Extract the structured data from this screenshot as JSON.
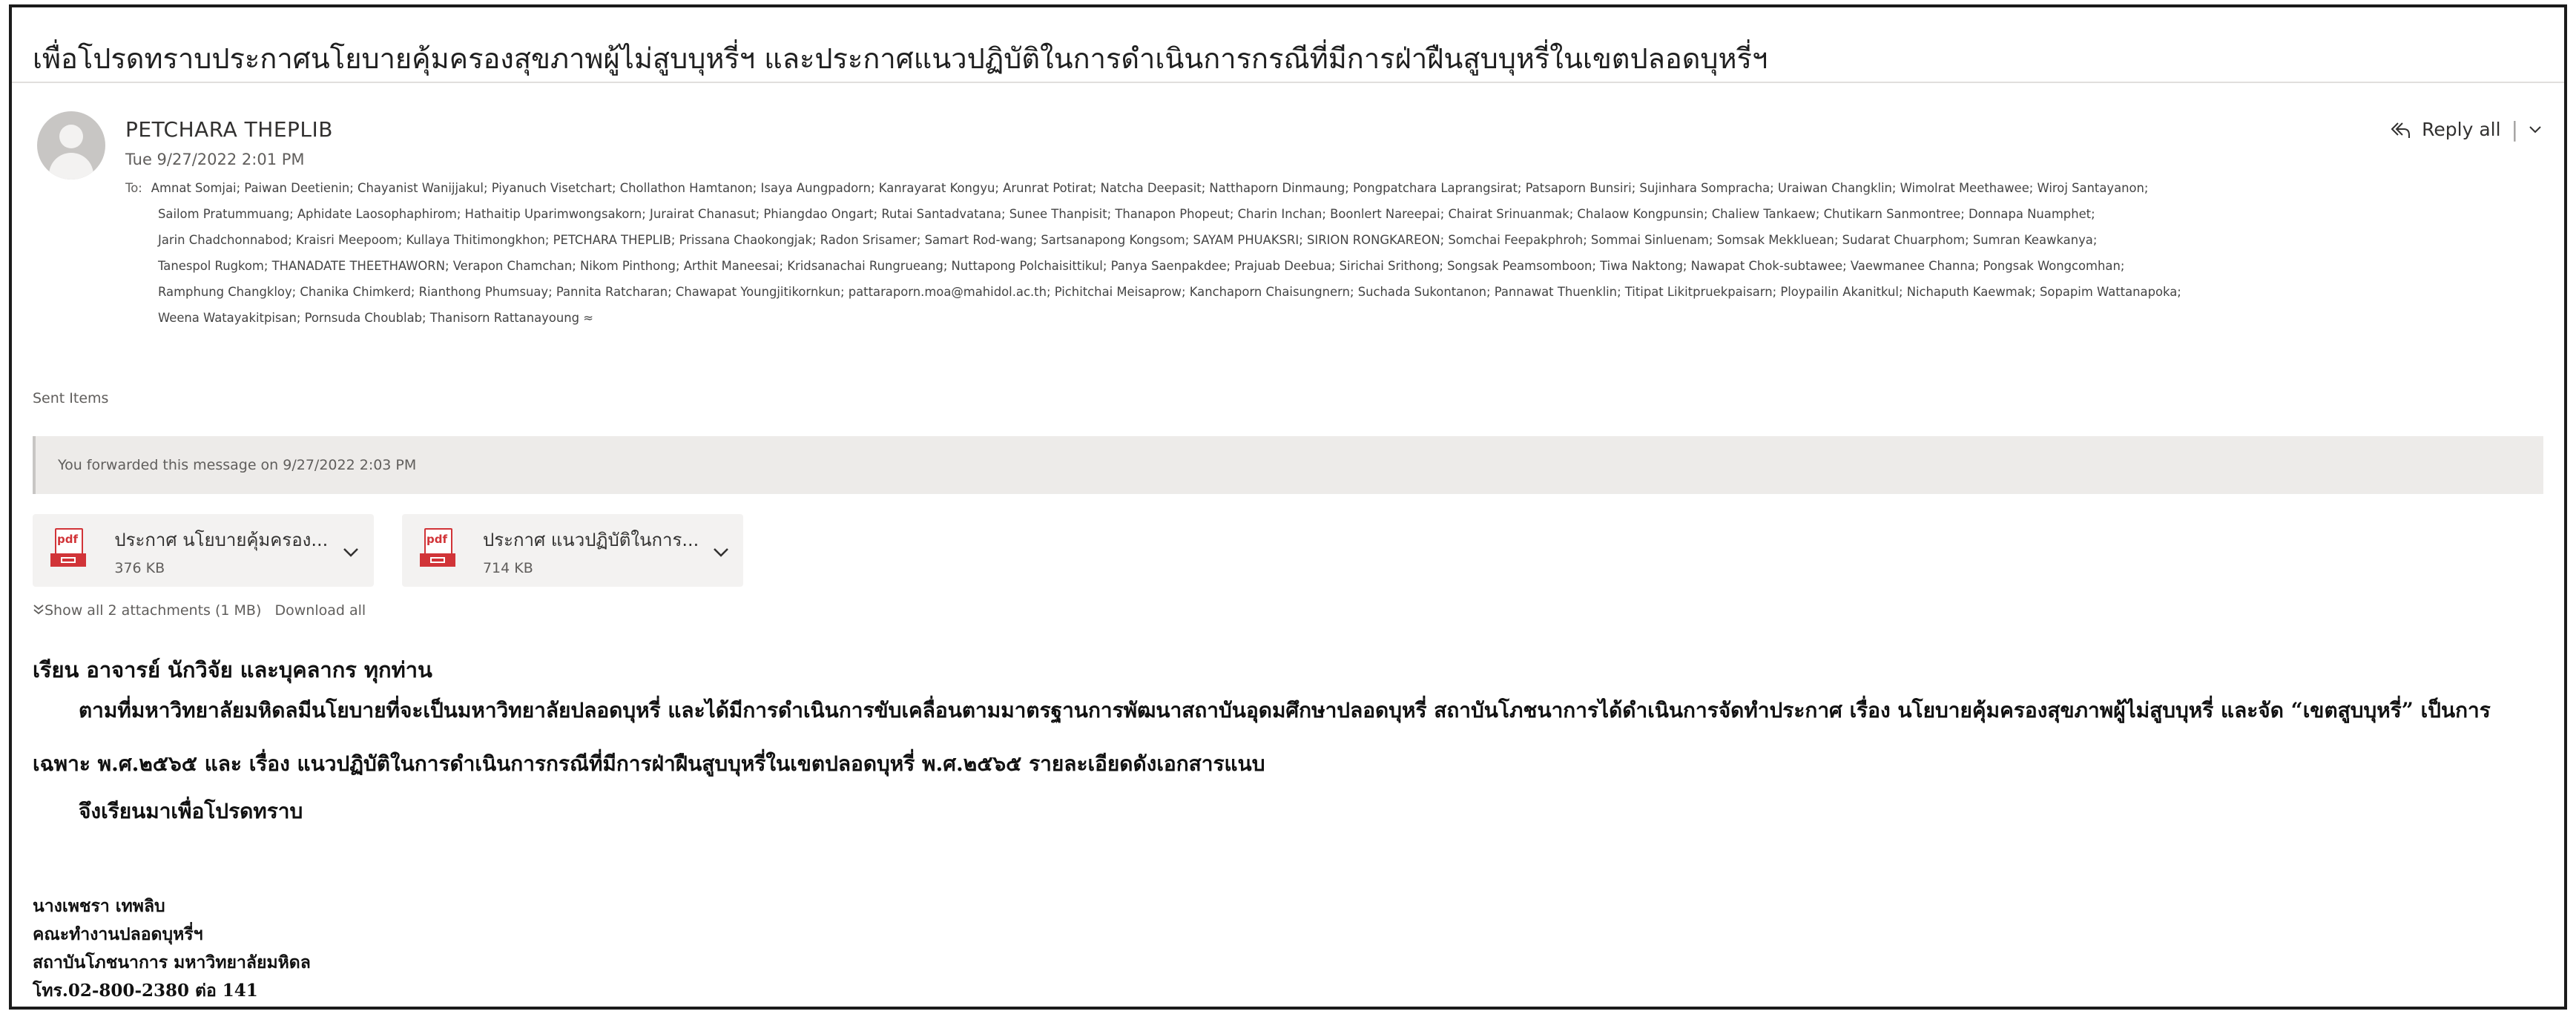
{
  "subject": "เพื่อโปรดทราบประกาศนโยบายคุ้มครองสุขภาพผู้ไม่สูบบุหรี่ฯ และประกาศแนวปฏิบัติในการดำเนินการกรณีที่มีการฝ่าฝืนสูบบุหรี่ในเขตปลอดบุหรี่ฯ",
  "sender": {
    "name": "PETCHARA THEPLIB",
    "date": "Tue 9/27/2022 2:01 PM"
  },
  "reply": {
    "label": "Reply all"
  },
  "recipients": {
    "to_label": "To:",
    "lines": [
      "Amnat Somjai; Paiwan Deetienin; Chayanist Wanijjakul; Piyanuch Visetchart; Chollathon Hamtanon; Isaya Aungpadorn; Kanrayarat Kongyu; Arunrat Potirat; Natcha Deepasit; Natthaporn Dinmaung; Pongpatchara Laprangsirat; Patsaporn Bunsiri; Sujinhara Sompracha; Uraiwan Changklin; Wimolrat Meethawee; Wiroj Santayanon;",
      "Sailom Pratummuang; Aphidate Laosophaphirom; Hathaitip Uparimwongsakorn; Jurairat Chanasut; Phiangdao Ongart; Rutai Santadvatana; Sunee Thanpisit; Thanapon Phopeut; Charin Inchan; Boonlert Nareepai; Chairat Srinuanmak; Chalaow Kongpunsin; Chaliew Tankaew; Chutikarn Sanmontree; Donnapa Nuamphet;",
      "Jarin Chadchonnabod; Kraisri Meepoom; Kullaya Thitimongkhon; PETCHARA THEPLIB; Prissana Chaokongjak; Radon Srisamer; Samart Rod-wang; Sartsanapong Kongsom; SAYAM PHUAKSRI; SIRION RONGKAREON; Somchai Feepakphroh; Sommai Sinluenam; Somsak Mekkluean; Sudarat Chuarphom; Sumran Keawkanya;",
      "Tanespol Rugkom; THANADATE THEETHAWORN; Verapon Chamchan; Nikom Pinthong; Arthit Maneesai; Kridsanachai Rungrueang; Nuttapong Polchaisittikul; Panya Saenpakdee; Prajuab Deebua; Sirichai Srithong; Songsak Peamsomboon; Tiwa Naktong; Nawapat Chok-subtawee; Vaewmanee Channa; Pongsak Wongcomhan;",
      "Ramphung Changkloy; Chanika Chimkerd; Rianthong Phumsuay; Pannita Ratcharan; Chawapat Youngjitikornkun; pattaraporn.moa@mahidol.ac.th; Pichitchai Meisaprow; Kanchaporn Chaisungnern; Suchada Sukontanon; Pannawat Thuenklin; Titipat Likitpruekpaisarn; Ploypailin Akanitkul; Nichaputh Kaewmak; Sopapim Wattanapoka;",
      "Weena Watayakitpisan; Pornsuda Choublab; Thanisorn Rattanayoung"
    ],
    "collapse_glyph": "≈"
  },
  "folder": "Sent Items",
  "forward_notice": "You forwarded this message on 9/27/2022 2:03 PM",
  "attachments": [
    {
      "name": "ประกาศ นโยบายคุ้มครอง...",
      "size": "376 KB",
      "icon_label": "pdf"
    },
    {
      "name": "ประกาศ แนวปฏิบัติในการ...",
      "size": "714 KB",
      "icon_label": "pdf"
    }
  ],
  "attachment_actions": {
    "show_all": "Show all 2 attachments (1 MB)",
    "download_all": "Download all"
  },
  "body": {
    "greeting": "เรียน อาจารย์ นักวิจัย และบุคลากร ทุกท่าน",
    "para1": "ตามที่มหาวิทยาลัยมหิดลมีนโยบายที่จะเป็นมหาวิทยาลัยปลอดบุหรี่   และได้มีการดำเนินการขับเคลื่อนตามมาตรฐานการพัฒนาสถาบันอุดมศึกษาปลอดบุหรี่ สถาบันโภชนาการได้ดำเนินการจัดทำประกาศ เรื่อง  นโยบายคุ้มครองสุขภาพผู้ไม่สูบบุหรี่ และจัด “เขตสูบบุหรี่” เป็นการ",
    "para1_cont": "เฉพาะ พ.ศ.๒๕๖๕ และ เรื่อง  แนวปฏิบัติในการดำเนินการกรณีที่มีการฝ่าฝืนสูบบุหรี่ในเขตปลอดบุหรี่ พ.ศ.๒๕๖๕ รายละเอียดดังเอกสารแนบ",
    "closing": "จึงเรียนมาเพื่อโปรดทราบ"
  },
  "signature": [
    "นางเพชรา เทพลิบ",
    "คณะทำงานปลอดบุหรี่ฯ",
    "สถาบันโภชนาการ มหาวิทยาลัยมหิดล",
    "โทร.02-800-2380 ต่อ 141"
  ]
}
